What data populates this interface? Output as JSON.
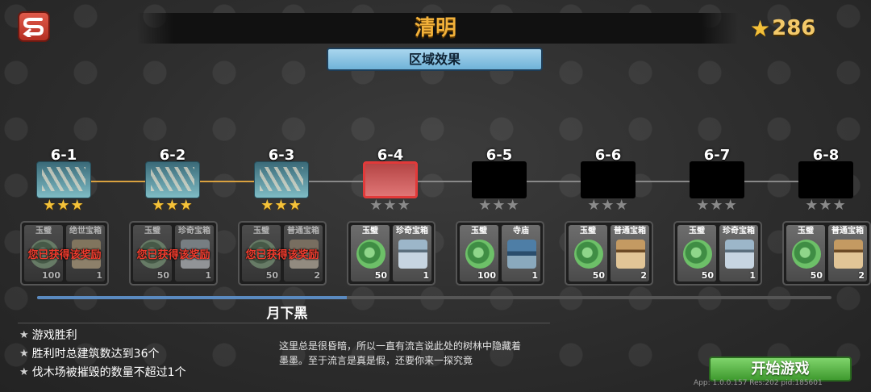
{
  "header": {
    "title": "清明",
    "star_total": "286"
  },
  "area_effect_label": "区域效果",
  "stages": [
    {
      "id": "6-1",
      "state": "done",
      "stars": 3,
      "claimed": true,
      "claimed_text": "您已获得该奖励",
      "rewards": [
        {
          "name": "玉璧",
          "count": "100",
          "icon": "jade-icon"
        },
        {
          "name": "绝世宝箱",
          "count": "1",
          "icon": "gold-chest-icon"
        }
      ]
    },
    {
      "id": "6-2",
      "state": "done",
      "stars": 3,
      "claimed": true,
      "claimed_text": "您已获得该奖励",
      "rewards": [
        {
          "name": "玉璧",
          "count": "50",
          "icon": "jade-icon"
        },
        {
          "name": "珍奇宝箱",
          "count": "1",
          "icon": "silver-chest-icon"
        }
      ]
    },
    {
      "id": "6-3",
      "state": "done",
      "stars": 3,
      "claimed": true,
      "claimed_text": "您已获得该奖励",
      "rewards": [
        {
          "name": "玉璧",
          "count": "50",
          "icon": "jade-icon"
        },
        {
          "name": "普通宝箱",
          "count": "2",
          "icon": "wood-chest-icon"
        }
      ]
    },
    {
      "id": "6-4",
      "state": "current",
      "stars": 0,
      "claimed": false,
      "claimed_text": "",
      "rewards": [
        {
          "name": "玉璧",
          "count": "50",
          "icon": "jade-icon"
        },
        {
          "name": "珍奇宝箱",
          "count": "1",
          "icon": "silver-chest-icon"
        }
      ]
    },
    {
      "id": "6-5",
      "state": "locked",
      "stars": 0,
      "claimed": false,
      "claimed_text": "",
      "rewards": [
        {
          "name": "玉璧",
          "count": "100",
          "icon": "jade-icon"
        },
        {
          "name": "寺庙",
          "count": "1",
          "icon": "temple-icon"
        }
      ]
    },
    {
      "id": "6-6",
      "state": "locked",
      "stars": 0,
      "claimed": false,
      "claimed_text": "",
      "rewards": [
        {
          "name": "玉璧",
          "count": "50",
          "icon": "jade-icon"
        },
        {
          "name": "普通宝箱",
          "count": "2",
          "icon": "wood-chest-icon"
        }
      ]
    },
    {
      "id": "6-7",
      "state": "locked",
      "stars": 0,
      "claimed": false,
      "claimed_text": "",
      "rewards": [
        {
          "name": "玉璧",
          "count": "50",
          "icon": "jade-icon"
        },
        {
          "name": "珍奇宝箱",
          "count": "1",
          "icon": "silver-chest-icon"
        }
      ]
    },
    {
      "id": "6-8",
      "state": "locked",
      "stars": 0,
      "claimed": false,
      "claimed_text": "",
      "rewards": [
        {
          "name": "玉璧",
          "count": "50",
          "icon": "jade-icon"
        },
        {
          "name": "普通宝箱",
          "count": "2",
          "icon": "wood-chest-icon"
        }
      ]
    }
  ],
  "scroll_progress": 0.39,
  "stage_info": {
    "name": "月下黑",
    "objectives": [
      "游戏胜利",
      "胜利时总建筑数达到36个",
      "伐木场被摧毁的数量不超过1个"
    ],
    "description_lines": [
      "这里总是很昏暗，所以一直有流言说此处的树林中隐藏着",
      "墨墨。至于流言是真是假，还要你来一探究竟"
    ]
  },
  "start_button_label": "开始游戏",
  "build_info": "App: 1.0.0.157 Res:202 pid:185601",
  "colors": {
    "title": "#f2b13a",
    "claimed": "#f03c2e",
    "start": "#5cb846",
    "current_border": "#e23a3a",
    "star": "#f4c23a"
  }
}
